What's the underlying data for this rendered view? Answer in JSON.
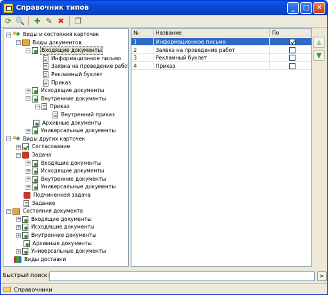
{
  "window": {
    "title": "Справочник типов"
  },
  "toolbar": {
    "buttons": [
      {
        "name": "refresh-icon",
        "glyph": "⟳",
        "color": "#2e8b2e"
      },
      {
        "name": "search-icon",
        "glyph": "🔍",
        "color": "#333333"
      },
      {
        "name": "add-icon",
        "glyph": "✚",
        "color": "#2e9a2e"
      },
      {
        "name": "edit-icon",
        "glyph": "✎",
        "color": "#555555"
      },
      {
        "name": "delete-icon",
        "glyph": "✖",
        "color": "#d62b1c"
      },
      {
        "name": "copy-icon",
        "glyph": "❐",
        "color": "#555555"
      }
    ]
  },
  "tree": [
    {
      "label": "Виды и состояния карточек",
      "depth": 0,
      "exp": "-",
      "icon": "people"
    },
    {
      "label": "Виды документов",
      "depth": 1,
      "exp": "-",
      "icon": "box"
    },
    {
      "label": "Входящие документы",
      "depth": 2,
      "exp": "-",
      "icon": "docgreen",
      "selected": true
    },
    {
      "label": "Информационное письмо",
      "depth": 3,
      "exp": "",
      "icon": "doc"
    },
    {
      "label": "Заявка на проведение работ",
      "depth": 3,
      "exp": "",
      "icon": "doc"
    },
    {
      "label": "Рекламный буклет",
      "depth": 3,
      "exp": "",
      "icon": "doc"
    },
    {
      "label": "Приказ",
      "depth": 3,
      "exp": "",
      "icon": "doc"
    },
    {
      "label": "Исходящие документы",
      "depth": 2,
      "exp": "+",
      "icon": "docgreen"
    },
    {
      "label": "Внутренние документы",
      "depth": 2,
      "exp": "-",
      "icon": "docgreen"
    },
    {
      "label": "Приказ",
      "depth": 3,
      "exp": "-",
      "icon": "doc"
    },
    {
      "label": "Внутренний приказ",
      "depth": 4,
      "exp": "",
      "icon": "doc"
    },
    {
      "label": "Архивные документы",
      "depth": 2,
      "exp": "",
      "icon": "docgreen"
    },
    {
      "label": "Универсальные документы",
      "depth": 2,
      "exp": "+",
      "icon": "docgreen"
    },
    {
      "label": "Виды других карточек",
      "depth": 0,
      "exp": "-",
      "icon": "people"
    },
    {
      "label": "Согласование",
      "depth": 1,
      "exp": "+",
      "icon": "check"
    },
    {
      "label": "Задача",
      "depth": 1,
      "exp": "-",
      "icon": "red"
    },
    {
      "label": "Входящие документы",
      "depth": 2,
      "exp": "+",
      "icon": "docgreen"
    },
    {
      "label": "Исходящие документы",
      "depth": 2,
      "exp": "+",
      "icon": "docgreen"
    },
    {
      "label": "Внутренние документы",
      "depth": 2,
      "exp": "+",
      "icon": "docgreen"
    },
    {
      "label": "Универсальные документы",
      "depth": 2,
      "exp": "+",
      "icon": "docgreen"
    },
    {
      "label": "Подчиненная задача",
      "depth": 1,
      "exp": "",
      "icon": "red"
    },
    {
      "label": "Задание",
      "depth": 1,
      "exp": "",
      "icon": "doc"
    },
    {
      "label": "Состояния документа",
      "depth": 0,
      "exp": "-",
      "icon": "box"
    },
    {
      "label": "Входящие документы",
      "depth": 1,
      "exp": "+",
      "icon": "docgreen"
    },
    {
      "label": "Исходящие документы",
      "depth": 1,
      "exp": "+",
      "icon": "docgreen"
    },
    {
      "label": "Внутренние документы",
      "depth": 1,
      "exp": "+",
      "icon": "docgreen"
    },
    {
      "label": "Архивные документы",
      "depth": 1,
      "exp": "",
      "icon": "docgreen"
    },
    {
      "label": "Универсальные документы",
      "depth": 1,
      "exp": "+",
      "icon": "docgreen"
    },
    {
      "label": "Виды доставки",
      "depth": 0,
      "exp": "",
      "icon": "multi"
    }
  ],
  "grid": {
    "columns": [
      "№",
      "Название",
      "По умолчанию"
    ],
    "rows": [
      {
        "num": "1",
        "name": "Информационное письмо",
        "default": true,
        "selected": true
      },
      {
        "num": "2",
        "name": "Заявка на проведение работ",
        "default": false,
        "selected": false
      },
      {
        "num": "3",
        "name": "Рекламный буклет",
        "default": false,
        "selected": false
      },
      {
        "num": "4",
        "name": "Приказ",
        "default": false,
        "selected": false
      }
    ]
  },
  "side_buttons": [
    {
      "name": "move-up-icon",
      "glyph": "▲",
      "color": "#9acc9a"
    },
    {
      "name": "move-down-icon",
      "glyph": "▼",
      "color": "#2e9a2e"
    }
  ],
  "search": {
    "label": "Быстрый поиск:",
    "value": "",
    "go_glyph": ">"
  },
  "status": {
    "text": "Справочники"
  }
}
